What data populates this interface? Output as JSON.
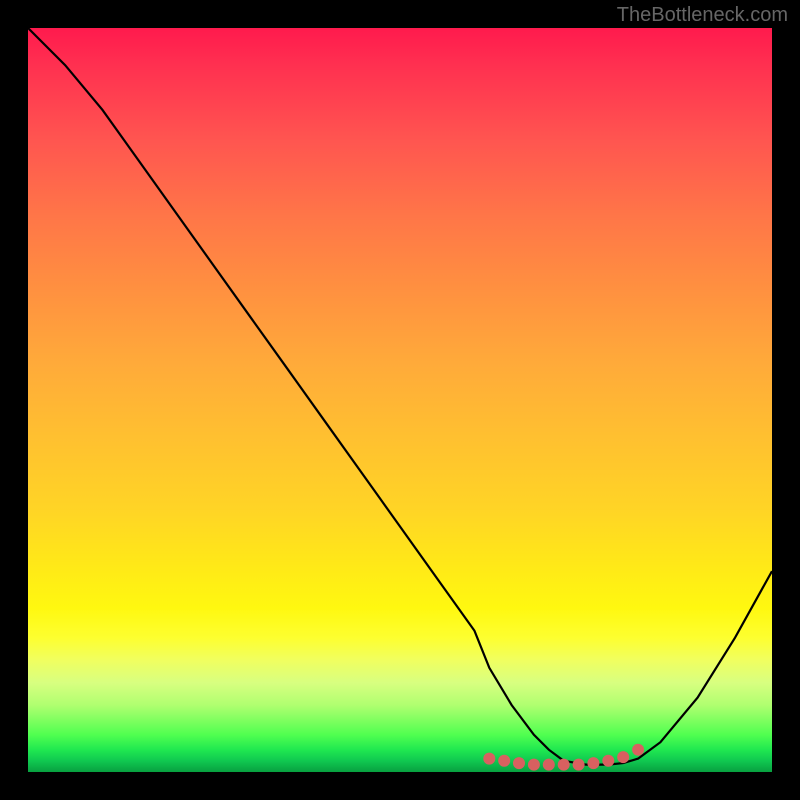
{
  "watermark": "TheBottleneck.com",
  "chart_data": {
    "type": "line",
    "title": "",
    "xlabel": "",
    "ylabel": "",
    "xlim": [
      0,
      100
    ],
    "ylim": [
      0,
      100
    ],
    "series": [
      {
        "name": "bottleneck-curve",
        "x": [
          0,
          5,
          10,
          15,
          20,
          25,
          30,
          35,
          40,
          45,
          50,
          55,
          60,
          62,
          65,
          68,
          70,
          72,
          75,
          78,
          80,
          82,
          85,
          90,
          95,
          100
        ],
        "y": [
          100,
          95,
          89,
          82,
          75,
          68,
          61,
          54,
          47,
          40,
          33,
          26,
          19,
          14,
          9,
          5,
          3,
          1.5,
          1,
          1,
          1.2,
          1.8,
          4,
          10,
          18,
          27
        ],
        "color": "#000000"
      },
      {
        "name": "optimal-markers",
        "type": "scatter",
        "x": [
          62,
          64,
          66,
          68,
          70,
          72,
          74,
          76,
          78,
          80,
          82
        ],
        "y": [
          1.8,
          1.5,
          1.2,
          1.0,
          1.0,
          1.0,
          1.0,
          1.2,
          1.5,
          2.0,
          3.0
        ],
        "color": "#d86060"
      }
    ],
    "background": {
      "type": "vertical-gradient",
      "stops": [
        {
          "pos": 0,
          "color": "#ff1a4d"
        },
        {
          "pos": 50,
          "color": "#ffaa3a"
        },
        {
          "pos": 80,
          "color": "#fff810"
        },
        {
          "pos": 95,
          "color": "#50ff50"
        },
        {
          "pos": 100,
          "color": "#08a040"
        }
      ]
    }
  }
}
